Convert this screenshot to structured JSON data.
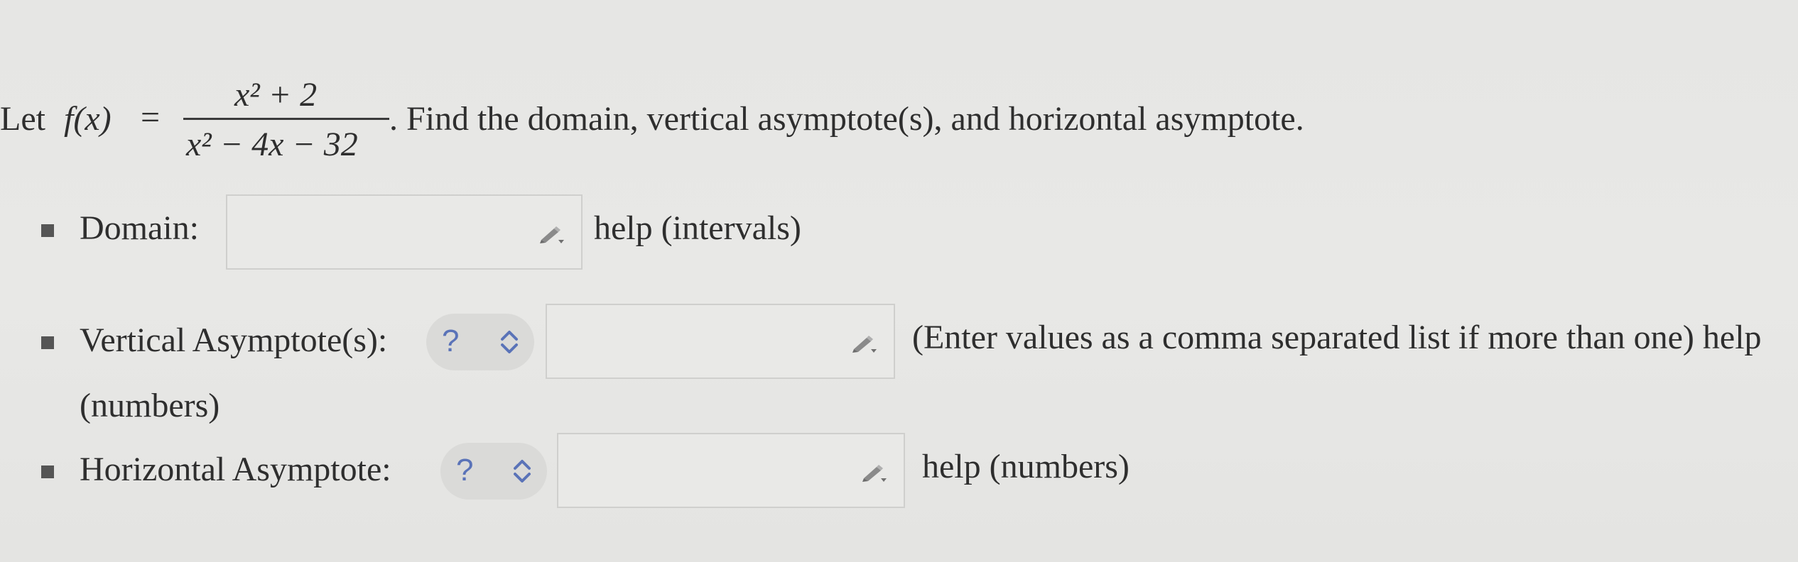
{
  "problem": {
    "let_text": "Let",
    "function_name": "f(x)",
    "equals": "=",
    "numerator": "x² + 2",
    "denominator": "x² − 4x − 32",
    "period": ".",
    "instruction": "Find the domain, vertical asymptote(s), and horizontal asymptote."
  },
  "domain": {
    "label": "Domain:",
    "input_value": "",
    "help_text": "help (intervals)"
  },
  "vertical_asymptotes": {
    "label": "Vertical Asymptote(s):",
    "selector_value": "?",
    "input_value": "",
    "instruction_text": "(Enter values as a comma separated list if more than one) help",
    "help_continuation": "(numbers)"
  },
  "horizontal_asymptote": {
    "label": "Horizontal Asymptote:",
    "selector_value": "?",
    "input_value": "",
    "help_text": "help (numbers)"
  },
  "icons": {
    "pencil": "pencil-icon",
    "bullet": "square-bullet",
    "selector_arrows": "up-down-chevron-icon"
  },
  "colors": {
    "selector_question": "#5a73b8",
    "text": "#2e2e2e"
  }
}
